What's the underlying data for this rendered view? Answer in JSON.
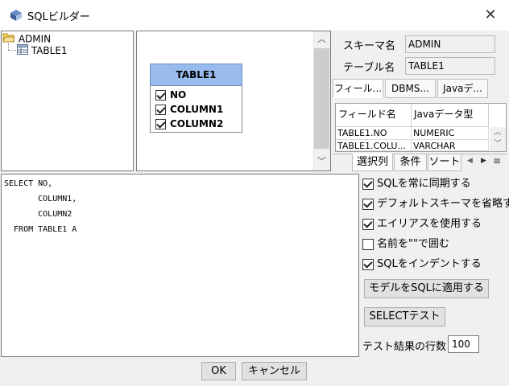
{
  "window": {
    "title": "SQLビルダー",
    "close_glyph": "✕"
  },
  "tree": {
    "root": "ADMIN",
    "child": "TABLE1"
  },
  "entity": {
    "name": "TABLE1",
    "columns": [
      {
        "label": "NO",
        "checked": true
      },
      {
        "label": "COLUMN1",
        "checked": true
      },
      {
        "label": "COLUMN2",
        "checked": true
      }
    ]
  },
  "scroll": {
    "up": "︿",
    "down": "﹀"
  },
  "props": {
    "schema_label": "スキーマ名",
    "schema_value": "ADMIN",
    "table_label": "テーブル名",
    "table_value": "TABLE1"
  },
  "top_tabs": [
    "フィール...",
    "DBMS...",
    "Javaデ..."
  ],
  "grid": {
    "headers": [
      "フィールド名",
      "Javaデータ型"
    ],
    "rows": [
      [
        "TABLE1.NO",
        "NUMERIC"
      ],
      [
        "TABLE1.COLU...",
        "VARCHAR"
      ]
    ]
  },
  "bottom_tabs": [
    "選択列",
    "条件",
    "ソート"
  ],
  "tab_nav": {
    "prev": "◀",
    "next": "▶",
    "menu": "≡"
  },
  "sql_text": "SELECT NO,\n       COLUMN1,\n       COLUMN2\n  FROM TABLE1 A",
  "options": [
    {
      "label": "SQLを常に同期する",
      "checked": true
    },
    {
      "label": "デフォルトスキーマを省略する",
      "checked": true
    },
    {
      "label": "エイリアスを使用する",
      "checked": true
    },
    {
      "label": "名前を\"\"で囲む",
      "checked": false
    },
    {
      "label": "SQLをインデントする",
      "checked": true
    }
  ],
  "buttons": {
    "apply_model": "モデルをSQLに適用する",
    "select_test": "SELECTテスト",
    "ok": "OK",
    "cancel": "キャンセル"
  },
  "result_rows": {
    "label": "テスト結果の行数",
    "value": "100"
  },
  "colors": {
    "entity_header": "#99bbee",
    "window_bg": "#f0f0f0"
  }
}
